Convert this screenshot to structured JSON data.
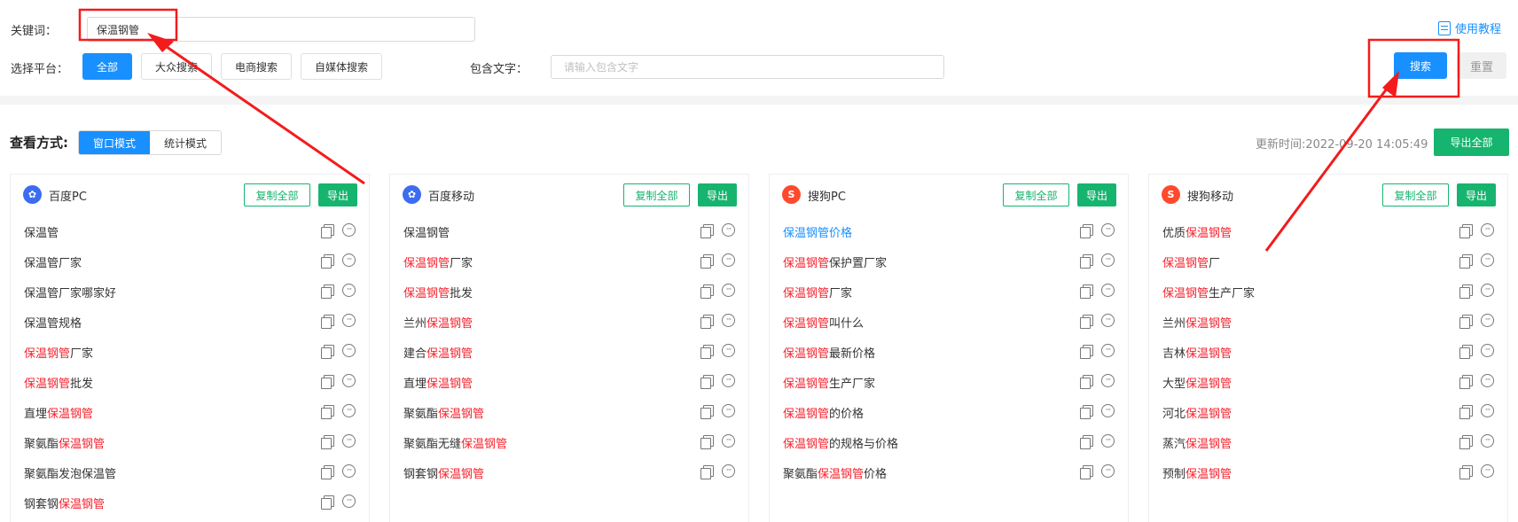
{
  "keyword": {
    "label": "关键词：",
    "value": "保温钢管"
  },
  "platform": {
    "label": "选择平台：",
    "options": [
      "全部",
      "大众搜索",
      "电商搜索",
      "自媒体搜索"
    ],
    "selected": "全部"
  },
  "include_text": {
    "label": "包含文字：",
    "placeholder": "请输入包含文字"
  },
  "tutorial_label": "使用教程",
  "search_label": "搜索",
  "reset_label": "重置",
  "view": {
    "label": "查看方式:",
    "modes": [
      "窗口模式",
      "统计模式"
    ],
    "selected": "窗口模式"
  },
  "update_time": "更新时间:2022-09-20 14:05:49",
  "export_all_label": "导出全部",
  "copy_all_label": "复制全部",
  "export_label": "导出",
  "row_more_icon": "ellipsis-circle-icon",
  "row_copy_icon": "copy-icon",
  "highlight_color": "#f5222d",
  "accent_color": "#1890ff",
  "green_color": "#16b46e",
  "panels": [
    {
      "title": "百度PC",
      "engine": "baidu",
      "items": [
        {
          "pre": "保温管",
          "hl": "",
          "post": ""
        },
        {
          "pre": "保温管厂家",
          "hl": "",
          "post": ""
        },
        {
          "pre": "保温管厂家哪家好",
          "hl": "",
          "post": ""
        },
        {
          "pre": "保温管规格",
          "hl": "",
          "post": ""
        },
        {
          "pre": "",
          "hl": "保温钢管",
          "post": "厂家"
        },
        {
          "pre": "",
          "hl": "保温钢管",
          "post": "批发"
        },
        {
          "pre": "直埋",
          "hl": "保温钢管",
          "post": ""
        },
        {
          "pre": "聚氨酯",
          "hl": "保温钢管",
          "post": ""
        },
        {
          "pre": "聚氨酯发泡保温管",
          "hl": "",
          "post": ""
        },
        {
          "pre": "钢套钢",
          "hl": "保温钢管",
          "post": ""
        }
      ]
    },
    {
      "title": "百度移动",
      "engine": "baidu",
      "items": [
        {
          "pre": "保温钢管",
          "hl": "",
          "post": ""
        },
        {
          "pre": "",
          "hl": "保温钢管",
          "post": "厂家"
        },
        {
          "pre": "",
          "hl": "保温钢管",
          "post": "批发"
        },
        {
          "pre": "兰州",
          "hl": "保温钢管",
          "post": ""
        },
        {
          "pre": "建合",
          "hl": "保温钢管",
          "post": ""
        },
        {
          "pre": "直埋",
          "hl": "保温钢管",
          "post": ""
        },
        {
          "pre": "聚氨酯",
          "hl": "保温钢管",
          "post": ""
        },
        {
          "pre": "聚氨酯无缝",
          "hl": "保温钢管",
          "post": ""
        },
        {
          "pre": "钢套钢",
          "hl": "保温钢管",
          "post": ""
        }
      ]
    },
    {
      "title": "搜狗PC",
      "engine": "sogou",
      "items": [
        {
          "pre": "保温钢管价格",
          "hl": "",
          "post": "",
          "link": true
        },
        {
          "pre": "",
          "hl": "保温钢管",
          "post": "保护置厂家"
        },
        {
          "pre": "",
          "hl": "保温钢管",
          "post": "厂家"
        },
        {
          "pre": "",
          "hl": "保温钢管",
          "post": "叫什么"
        },
        {
          "pre": "",
          "hl": "保温钢管",
          "post": "最新价格"
        },
        {
          "pre": "",
          "hl": "保温钢管",
          "post": "生产厂家"
        },
        {
          "pre": "",
          "hl": "保温钢管",
          "post": "的价格"
        },
        {
          "pre": "",
          "hl": "保温钢管",
          "post": "的规格与价格"
        },
        {
          "pre": "聚氨酯",
          "hl": "保温钢管",
          "post": "价格"
        }
      ]
    },
    {
      "title": "搜狗移动",
      "engine": "sogou",
      "items": [
        {
          "pre": "优质",
          "hl": "保温钢管",
          "post": ""
        },
        {
          "pre": "",
          "hl": "保温钢管",
          "post": "厂"
        },
        {
          "pre": "",
          "hl": "保温钢管",
          "post": "生产厂家"
        },
        {
          "pre": "兰州",
          "hl": "保温钢管",
          "post": ""
        },
        {
          "pre": "吉林",
          "hl": "保温钢管",
          "post": ""
        },
        {
          "pre": "大型",
          "hl": "保温钢管",
          "post": ""
        },
        {
          "pre": "河北",
          "hl": "保温钢管",
          "post": ""
        },
        {
          "pre": "蒸汽",
          "hl": "保温钢管",
          "post": ""
        },
        {
          "pre": "预制",
          "hl": "保温钢管",
          "post": ""
        }
      ]
    }
  ]
}
